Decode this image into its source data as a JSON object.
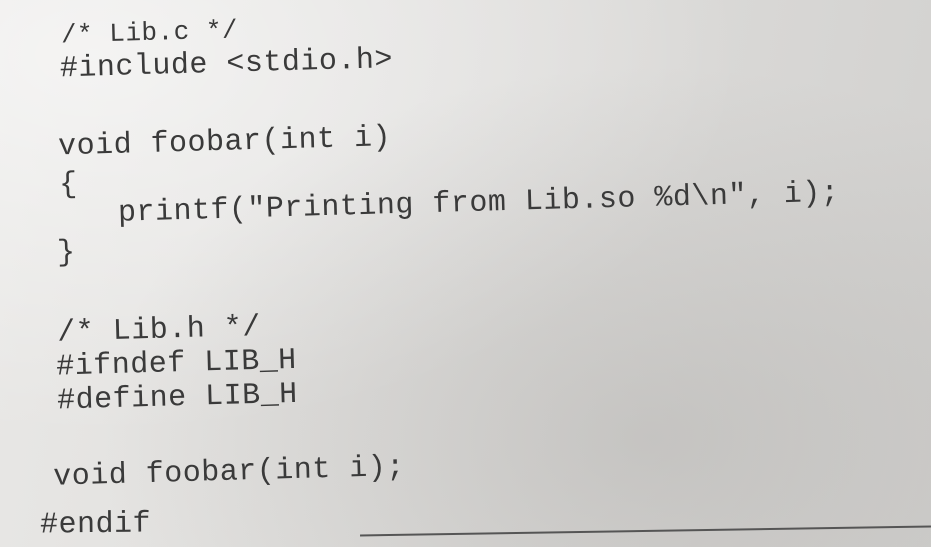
{
  "code_lines": [
    "/* Lib.c */",
    "#include <stdio.h>",
    "void foobar(int i)",
    "{",
    "printf(\"Printing from Lib.so %d\\n\", i);",
    "}",
    "/* Lib.h */",
    "#ifndef LIB_H",
    "#define LIB_H",
    "void foobar(int i);",
    "#endif"
  ]
}
